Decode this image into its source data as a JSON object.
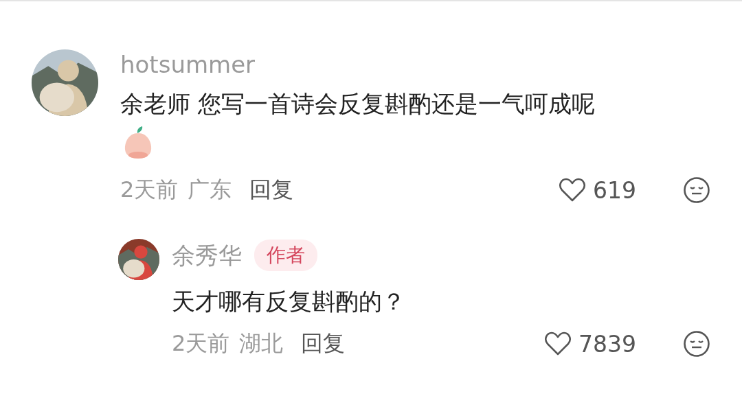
{
  "comments": [
    {
      "username": "hotsummer",
      "text": "余老师 您写一首诗会反复斟酌还是一气呵成呢",
      "sticker": true,
      "time": "2天前",
      "location": "广东",
      "reply_label": "回复",
      "likes": "619",
      "liked": false,
      "replies": [
        {
          "username": "余秀华",
          "badge": "作者",
          "text": "天才哪有反复斟酌的？",
          "time": "2天前",
          "location": "湖北",
          "reply_label": "回复",
          "likes": "7839",
          "liked": false
        }
      ]
    }
  ]
}
